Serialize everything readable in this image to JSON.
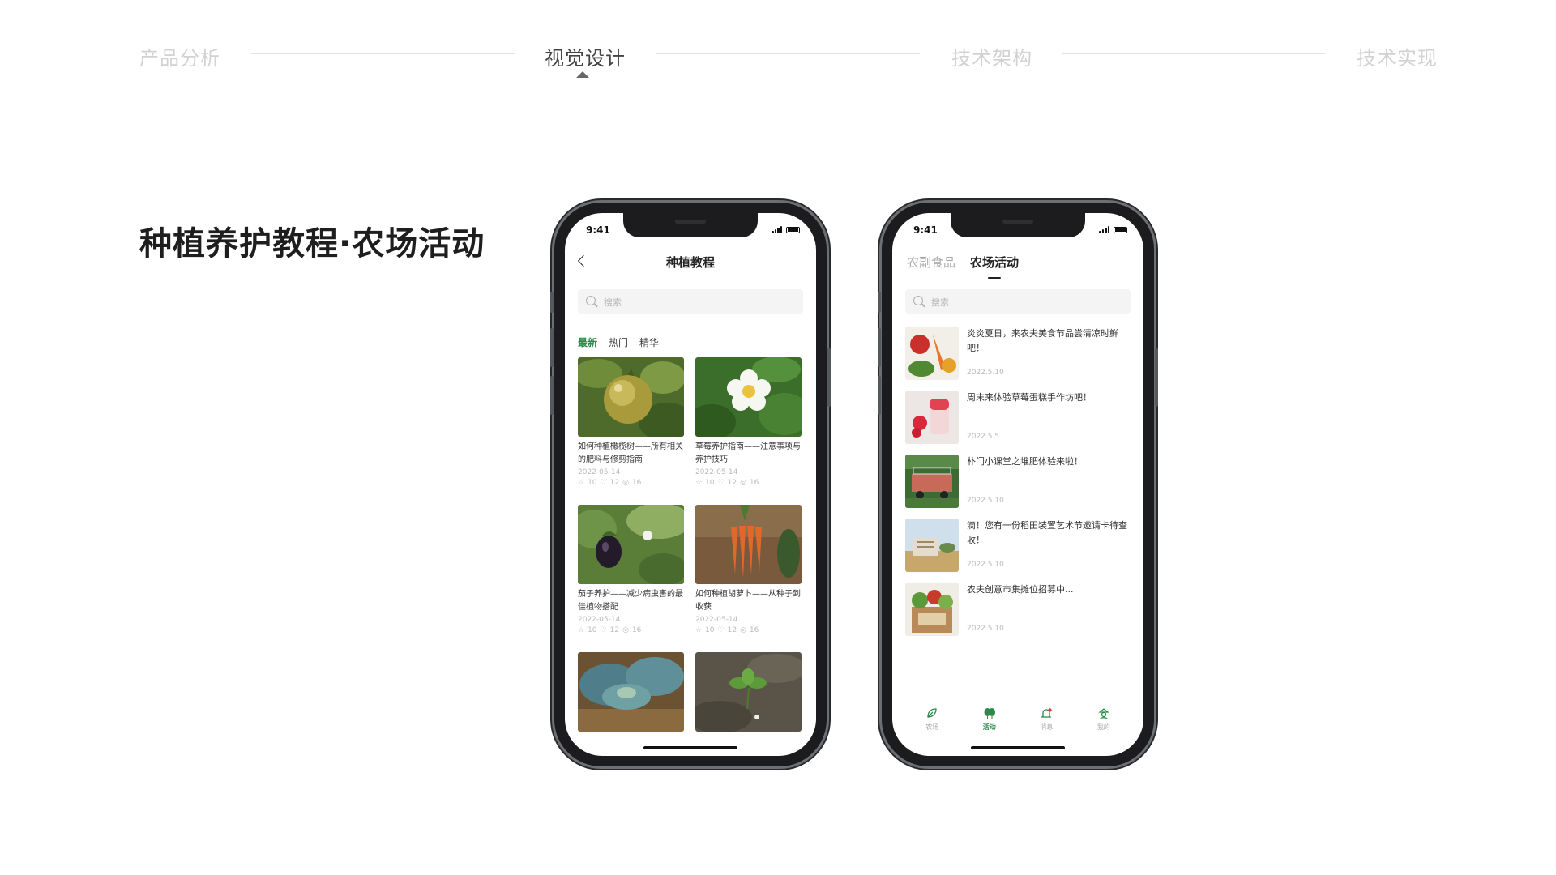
{
  "stepper": {
    "steps": [
      "产品分析",
      "视觉设计",
      "技术架构",
      "技术实现"
    ],
    "active": "视觉设计"
  },
  "heading": "种植养护教程·农场活动",
  "phone1": {
    "status_time": "9:41",
    "title": "种植教程",
    "search_placeholder": "搜索",
    "tabs": [
      "最新",
      "热门",
      "精华"
    ],
    "active_tab": "最新",
    "cards": [
      {
        "title": "如何种植橄榄树——所有相关的肥料与修剪指南",
        "date": "2022-05-14",
        "stars": "10",
        "likes": "12",
        "views": "16",
        "image": "green-tomato-photo"
      },
      {
        "title": "草莓养护指南——注意事项与养护技巧",
        "date": "2022-05-14",
        "stars": "10",
        "likes": "12",
        "views": "16",
        "image": "strawberry-flower-photo"
      },
      {
        "title": "茄子养护——减少病虫害的最佳植物搭配",
        "date": "2022-05-14",
        "stars": "10",
        "likes": "12",
        "views": "16",
        "image": "eggplant-photo"
      },
      {
        "title": "如何种植胡萝卜——从种子到收获",
        "date": "2022-05-14",
        "stars": "10",
        "likes": "12",
        "views": "16",
        "image": "carrots-photo"
      },
      {
        "title": "",
        "date": "",
        "stars": "",
        "likes": "",
        "views": "",
        "image": "cabbage-photo"
      },
      {
        "title": "",
        "date": "",
        "stars": "",
        "likes": "",
        "views": "",
        "image": "seedling-photo"
      }
    ]
  },
  "phone2": {
    "status_time": "9:41",
    "tabs": [
      "农副食品",
      "农场活动"
    ],
    "active_tab": "农场活动",
    "search_placeholder": "搜索",
    "items": [
      {
        "title": "炎炎夏日，来农夫美食节品尝清凉时鲜吧！",
        "date": "2022.5.10",
        "image": "vegetables-photo"
      },
      {
        "title": "周末来体验草莓蛋糕手作坊吧！",
        "date": "2022.5.5",
        "image": "strawberry-dessert-photo"
      },
      {
        "title": "朴门小课堂之堆肥体验来啦！",
        "date": "2022.5.10",
        "image": "farm-truck-photo"
      },
      {
        "title": "滴！您有一份稻田装置艺术节邀请卡待查收！",
        "date": "2022.5.10",
        "image": "rice-field-photo"
      },
      {
        "title": "农夫创意市集摊位招募中...",
        "date": "2022.5.10",
        "image": "produce-crate-photo"
      }
    ],
    "tabbar": [
      {
        "label": "农场",
        "icon": "leaf-icon"
      },
      {
        "label": "活动",
        "icon": "balloon-icon"
      },
      {
        "label": "消息",
        "icon": "bell-icon"
      },
      {
        "label": "我的",
        "icon": "user-icon"
      }
    ],
    "active_tabbar": "活动"
  },
  "colors": {
    "accent_green": "#2a8a4a",
    "stepper_inactive": "#d2d2d2",
    "stepper_active": "#444444"
  }
}
